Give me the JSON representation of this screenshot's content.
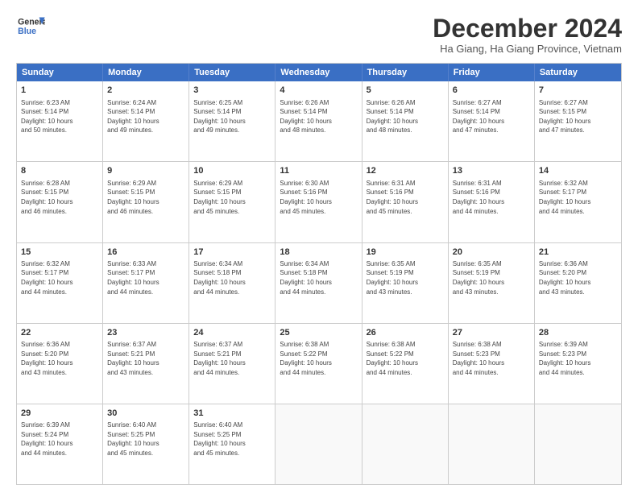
{
  "header": {
    "logo_line1": "General",
    "logo_line2": "Blue",
    "title": "December 2024",
    "location": "Ha Giang, Ha Giang Province, Vietnam"
  },
  "weekdays": [
    "Sunday",
    "Monday",
    "Tuesday",
    "Wednesday",
    "Thursday",
    "Friday",
    "Saturday"
  ],
  "rows": [
    [
      {
        "day": "1",
        "lines": [
          "Sunrise: 6:23 AM",
          "Sunset: 5:14 PM",
          "Daylight: 10 hours",
          "and 50 minutes."
        ]
      },
      {
        "day": "2",
        "lines": [
          "Sunrise: 6:24 AM",
          "Sunset: 5:14 PM",
          "Daylight: 10 hours",
          "and 49 minutes."
        ]
      },
      {
        "day": "3",
        "lines": [
          "Sunrise: 6:25 AM",
          "Sunset: 5:14 PM",
          "Daylight: 10 hours",
          "and 49 minutes."
        ]
      },
      {
        "day": "4",
        "lines": [
          "Sunrise: 6:26 AM",
          "Sunset: 5:14 PM",
          "Daylight: 10 hours",
          "and 48 minutes."
        ]
      },
      {
        "day": "5",
        "lines": [
          "Sunrise: 6:26 AM",
          "Sunset: 5:14 PM",
          "Daylight: 10 hours",
          "and 48 minutes."
        ]
      },
      {
        "day": "6",
        "lines": [
          "Sunrise: 6:27 AM",
          "Sunset: 5:14 PM",
          "Daylight: 10 hours",
          "and 47 minutes."
        ]
      },
      {
        "day": "7",
        "lines": [
          "Sunrise: 6:27 AM",
          "Sunset: 5:15 PM",
          "Daylight: 10 hours",
          "and 47 minutes."
        ]
      }
    ],
    [
      {
        "day": "8",
        "lines": [
          "Sunrise: 6:28 AM",
          "Sunset: 5:15 PM",
          "Daylight: 10 hours",
          "and 46 minutes."
        ]
      },
      {
        "day": "9",
        "lines": [
          "Sunrise: 6:29 AM",
          "Sunset: 5:15 PM",
          "Daylight: 10 hours",
          "and 46 minutes."
        ]
      },
      {
        "day": "10",
        "lines": [
          "Sunrise: 6:29 AM",
          "Sunset: 5:15 PM",
          "Daylight: 10 hours",
          "and 45 minutes."
        ]
      },
      {
        "day": "11",
        "lines": [
          "Sunrise: 6:30 AM",
          "Sunset: 5:16 PM",
          "Daylight: 10 hours",
          "and 45 minutes."
        ]
      },
      {
        "day": "12",
        "lines": [
          "Sunrise: 6:31 AM",
          "Sunset: 5:16 PM",
          "Daylight: 10 hours",
          "and 45 minutes."
        ]
      },
      {
        "day": "13",
        "lines": [
          "Sunrise: 6:31 AM",
          "Sunset: 5:16 PM",
          "Daylight: 10 hours",
          "and 44 minutes."
        ]
      },
      {
        "day": "14",
        "lines": [
          "Sunrise: 6:32 AM",
          "Sunset: 5:17 PM",
          "Daylight: 10 hours",
          "and 44 minutes."
        ]
      }
    ],
    [
      {
        "day": "15",
        "lines": [
          "Sunrise: 6:32 AM",
          "Sunset: 5:17 PM",
          "Daylight: 10 hours",
          "and 44 minutes."
        ]
      },
      {
        "day": "16",
        "lines": [
          "Sunrise: 6:33 AM",
          "Sunset: 5:17 PM",
          "Daylight: 10 hours",
          "and 44 minutes."
        ]
      },
      {
        "day": "17",
        "lines": [
          "Sunrise: 6:34 AM",
          "Sunset: 5:18 PM",
          "Daylight: 10 hours",
          "and 44 minutes."
        ]
      },
      {
        "day": "18",
        "lines": [
          "Sunrise: 6:34 AM",
          "Sunset: 5:18 PM",
          "Daylight: 10 hours",
          "and 44 minutes."
        ]
      },
      {
        "day": "19",
        "lines": [
          "Sunrise: 6:35 AM",
          "Sunset: 5:19 PM",
          "Daylight: 10 hours",
          "and 43 minutes."
        ]
      },
      {
        "day": "20",
        "lines": [
          "Sunrise: 6:35 AM",
          "Sunset: 5:19 PM",
          "Daylight: 10 hours",
          "and 43 minutes."
        ]
      },
      {
        "day": "21",
        "lines": [
          "Sunrise: 6:36 AM",
          "Sunset: 5:20 PM",
          "Daylight: 10 hours",
          "and 43 minutes."
        ]
      }
    ],
    [
      {
        "day": "22",
        "lines": [
          "Sunrise: 6:36 AM",
          "Sunset: 5:20 PM",
          "Daylight: 10 hours",
          "and 43 minutes."
        ]
      },
      {
        "day": "23",
        "lines": [
          "Sunrise: 6:37 AM",
          "Sunset: 5:21 PM",
          "Daylight: 10 hours",
          "and 43 minutes."
        ]
      },
      {
        "day": "24",
        "lines": [
          "Sunrise: 6:37 AM",
          "Sunset: 5:21 PM",
          "Daylight: 10 hours",
          "and 44 minutes."
        ]
      },
      {
        "day": "25",
        "lines": [
          "Sunrise: 6:38 AM",
          "Sunset: 5:22 PM",
          "Daylight: 10 hours",
          "and 44 minutes."
        ]
      },
      {
        "day": "26",
        "lines": [
          "Sunrise: 6:38 AM",
          "Sunset: 5:22 PM",
          "Daylight: 10 hours",
          "and 44 minutes."
        ]
      },
      {
        "day": "27",
        "lines": [
          "Sunrise: 6:38 AM",
          "Sunset: 5:23 PM",
          "Daylight: 10 hours",
          "and 44 minutes."
        ]
      },
      {
        "day": "28",
        "lines": [
          "Sunrise: 6:39 AM",
          "Sunset: 5:23 PM",
          "Daylight: 10 hours",
          "and 44 minutes."
        ]
      }
    ],
    [
      {
        "day": "29",
        "lines": [
          "Sunrise: 6:39 AM",
          "Sunset: 5:24 PM",
          "Daylight: 10 hours",
          "and 44 minutes."
        ]
      },
      {
        "day": "30",
        "lines": [
          "Sunrise: 6:40 AM",
          "Sunset: 5:25 PM",
          "Daylight: 10 hours",
          "and 45 minutes."
        ]
      },
      {
        "day": "31",
        "lines": [
          "Sunrise: 6:40 AM",
          "Sunset: 5:25 PM",
          "Daylight: 10 hours",
          "and 45 minutes."
        ]
      },
      {
        "day": "",
        "lines": []
      },
      {
        "day": "",
        "lines": []
      },
      {
        "day": "",
        "lines": []
      },
      {
        "day": "",
        "lines": []
      }
    ]
  ]
}
